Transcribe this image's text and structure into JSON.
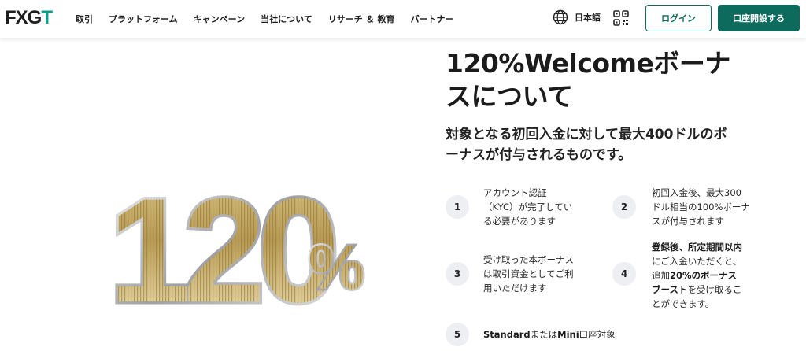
{
  "header": {
    "logo": {
      "fx": "FX",
      "g": "G",
      "t": "T"
    },
    "nav": [
      "取引",
      "プラットフォーム",
      "キャンペーン",
      "当社について",
      "リサーチ ＆ 教育",
      "パートナー"
    ],
    "language": "日本語",
    "login_label": "ログイン",
    "open_account_label": "口座開設する"
  },
  "hero": {
    "number": "120",
    "percent": "%"
  },
  "main": {
    "title_line1": "120%Welcomeボーナ",
    "title_line2": "スについて",
    "subtitle_line1": "対象となる初回入金に対して最大400ドルのボ",
    "subtitle_line2": "ーナスが付与されるものです。",
    "steps": [
      {
        "num": "1",
        "lines": [
          "アカウント認証",
          "（KYC）が完了してい",
          "る必要があります"
        ]
      },
      {
        "num": "2",
        "lines": [
          "初回入金後、最大300",
          "ドル相当の100%ボーナ",
          "スが付与されます"
        ]
      },
      {
        "num": "3",
        "lines": [
          "受け取った本ボーナス",
          "は取引資金としてご利",
          "用いただけます"
        ]
      },
      {
        "num": "4",
        "line1": "登録後、所定期間以内",
        "line2": "にご入金いただくと、",
        "line3_a": "追加",
        "line3_b": "20%のボーナス",
        "line4_a": "ブースト",
        "line4_b": "を受け取るこ",
        "line5": "とができます。"
      },
      {
        "num": "5",
        "part_a": "Standard",
        "part_b": "または",
        "part_c": "Mini",
        "part_d": "口座対象"
      }
    ]
  },
  "colors": {
    "brand": "#0c6b5d",
    "accent": "#0e9c84",
    "badge": "#eeeff2"
  },
  "icons": {
    "language": "globe-icon",
    "qr": "qr-code-icon"
  }
}
